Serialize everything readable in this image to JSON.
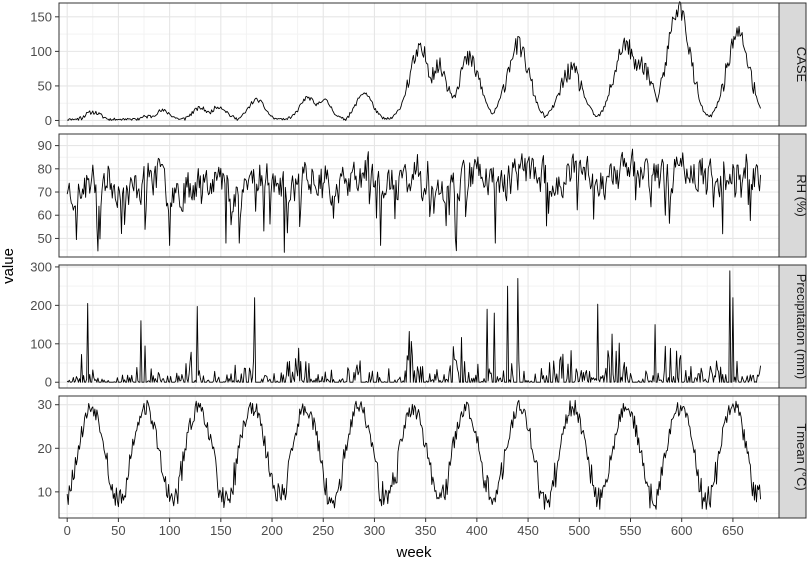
{
  "chart_data": {
    "type": "line",
    "xlabel": "week",
    "ylabel": "value",
    "xlim": [
      -8,
      695
    ],
    "x_ticks": [
      0,
      50,
      100,
      150,
      200,
      250,
      300,
      350,
      400,
      450,
      500,
      550,
      600,
      650
    ],
    "grid": true,
    "line_color": "#000000",
    "panel_border_color": "#333333",
    "grid_major_color": "#e6e6e6",
    "grid_minor_color": "#f3f3f3",
    "strip_fill": "#d9d9d9",
    "panels": [
      {
        "strip_label": "CASE",
        "ylim": [
          -8,
          170
        ],
        "y_ticks": [
          0,
          50,
          100,
          150
        ],
        "generator": "case",
        "peaks": [
          [
            25,
            12
          ],
          [
            80,
            6
          ],
          [
            93,
            14
          ],
          [
            130,
            18
          ],
          [
            148,
            20
          ],
          [
            185,
            30
          ],
          [
            235,
            33
          ],
          [
            250,
            30
          ],
          [
            290,
            40
          ],
          [
            345,
            100
          ],
          [
            362,
            78
          ],
          [
            392,
            88
          ],
          [
            440,
            108
          ],
          [
            492,
            72
          ],
          [
            545,
            110
          ],
          [
            560,
            83
          ],
          [
            597,
            163
          ],
          [
            655,
            125
          ]
        ]
      },
      {
        "strip_label": "RH (%)",
        "ylim": [
          42,
          95
        ],
        "y_ticks": [
          50,
          60,
          70,
          80,
          90
        ],
        "generator": "rh"
      },
      {
        "strip_label": "Precipitation (mm)",
        "ylim": [
          -15,
          305
        ],
        "y_ticks": [
          0,
          100,
          200,
          300
        ],
        "generator": "precip",
        "spikes": [
          [
            20,
            205
          ],
          [
            72,
            160
          ],
          [
            127,
            197
          ],
          [
            183,
            220
          ],
          [
            334,
            132
          ],
          [
            410,
            190
          ],
          [
            417,
            180
          ],
          [
            430,
            250
          ],
          [
            440,
            270
          ],
          [
            518,
            203
          ],
          [
            574,
            150
          ],
          [
            647,
            290
          ],
          [
            650,
            220
          ]
        ]
      },
      {
        "strip_label": "Tmean (°C)",
        "ylim": [
          4,
          32
        ],
        "y_ticks": [
          10,
          20,
          30
        ],
        "generator": "temp"
      }
    ],
    "n_weeks": 678
  }
}
